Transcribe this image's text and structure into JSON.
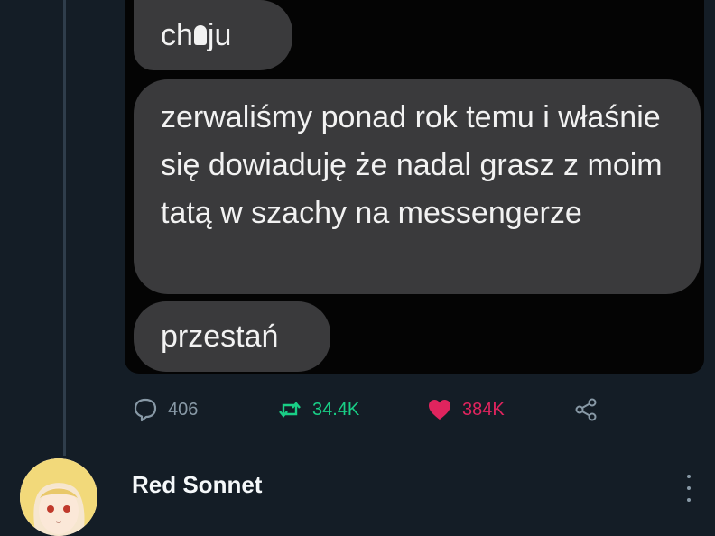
{
  "messages": [
    {
      "before": "ch",
      "after": "ju",
      "censored": true
    },
    {
      "text": "zerwaliśmy ponad rok temu i właśnie się dowiaduję że nadal grasz z moim tatą w szachy na messengerze"
    },
    {
      "text": "przestań"
    }
  ],
  "actions": {
    "replies": "406",
    "retweets": "34.4K",
    "likes": "384K"
  },
  "next_reply": {
    "username": "Red Sonnet"
  },
  "colors": {
    "background": "#141d26",
    "bubble": "#3a3a3c",
    "retweet": "#19cf86",
    "like": "#e0245e",
    "muted": "#8899a6"
  },
  "icons": [
    "reply-icon",
    "retweet-icon",
    "heart-icon",
    "share-icon",
    "more-icon"
  ]
}
